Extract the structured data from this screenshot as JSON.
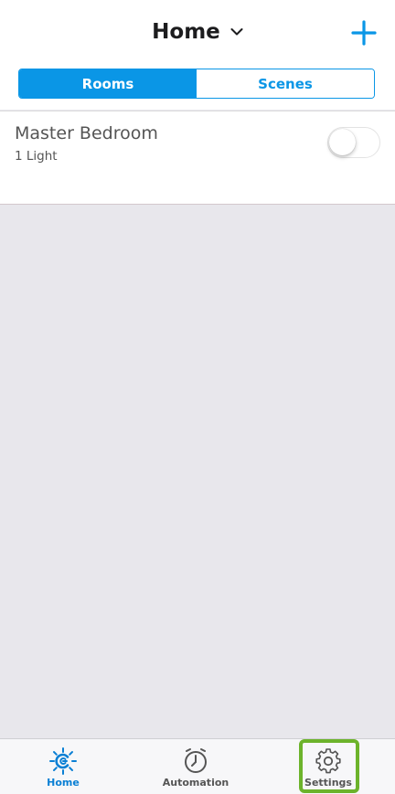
{
  "header": {
    "title": "Home",
    "add_icon": "plus-icon"
  },
  "segments": {
    "rooms": "Rooms",
    "scenes": "Scenes",
    "selected": "Rooms"
  },
  "rooms": [
    {
      "name": "Master Bedroom",
      "subtitle": "1 Light",
      "on": false
    }
  ],
  "tabbar": {
    "home": "Home",
    "automation": "Automation",
    "settings": "Settings",
    "active": "Home"
  },
  "colors": {
    "accent": "#0a96e6",
    "highlight": "#6cb32b",
    "background": "#e8e7ec"
  }
}
